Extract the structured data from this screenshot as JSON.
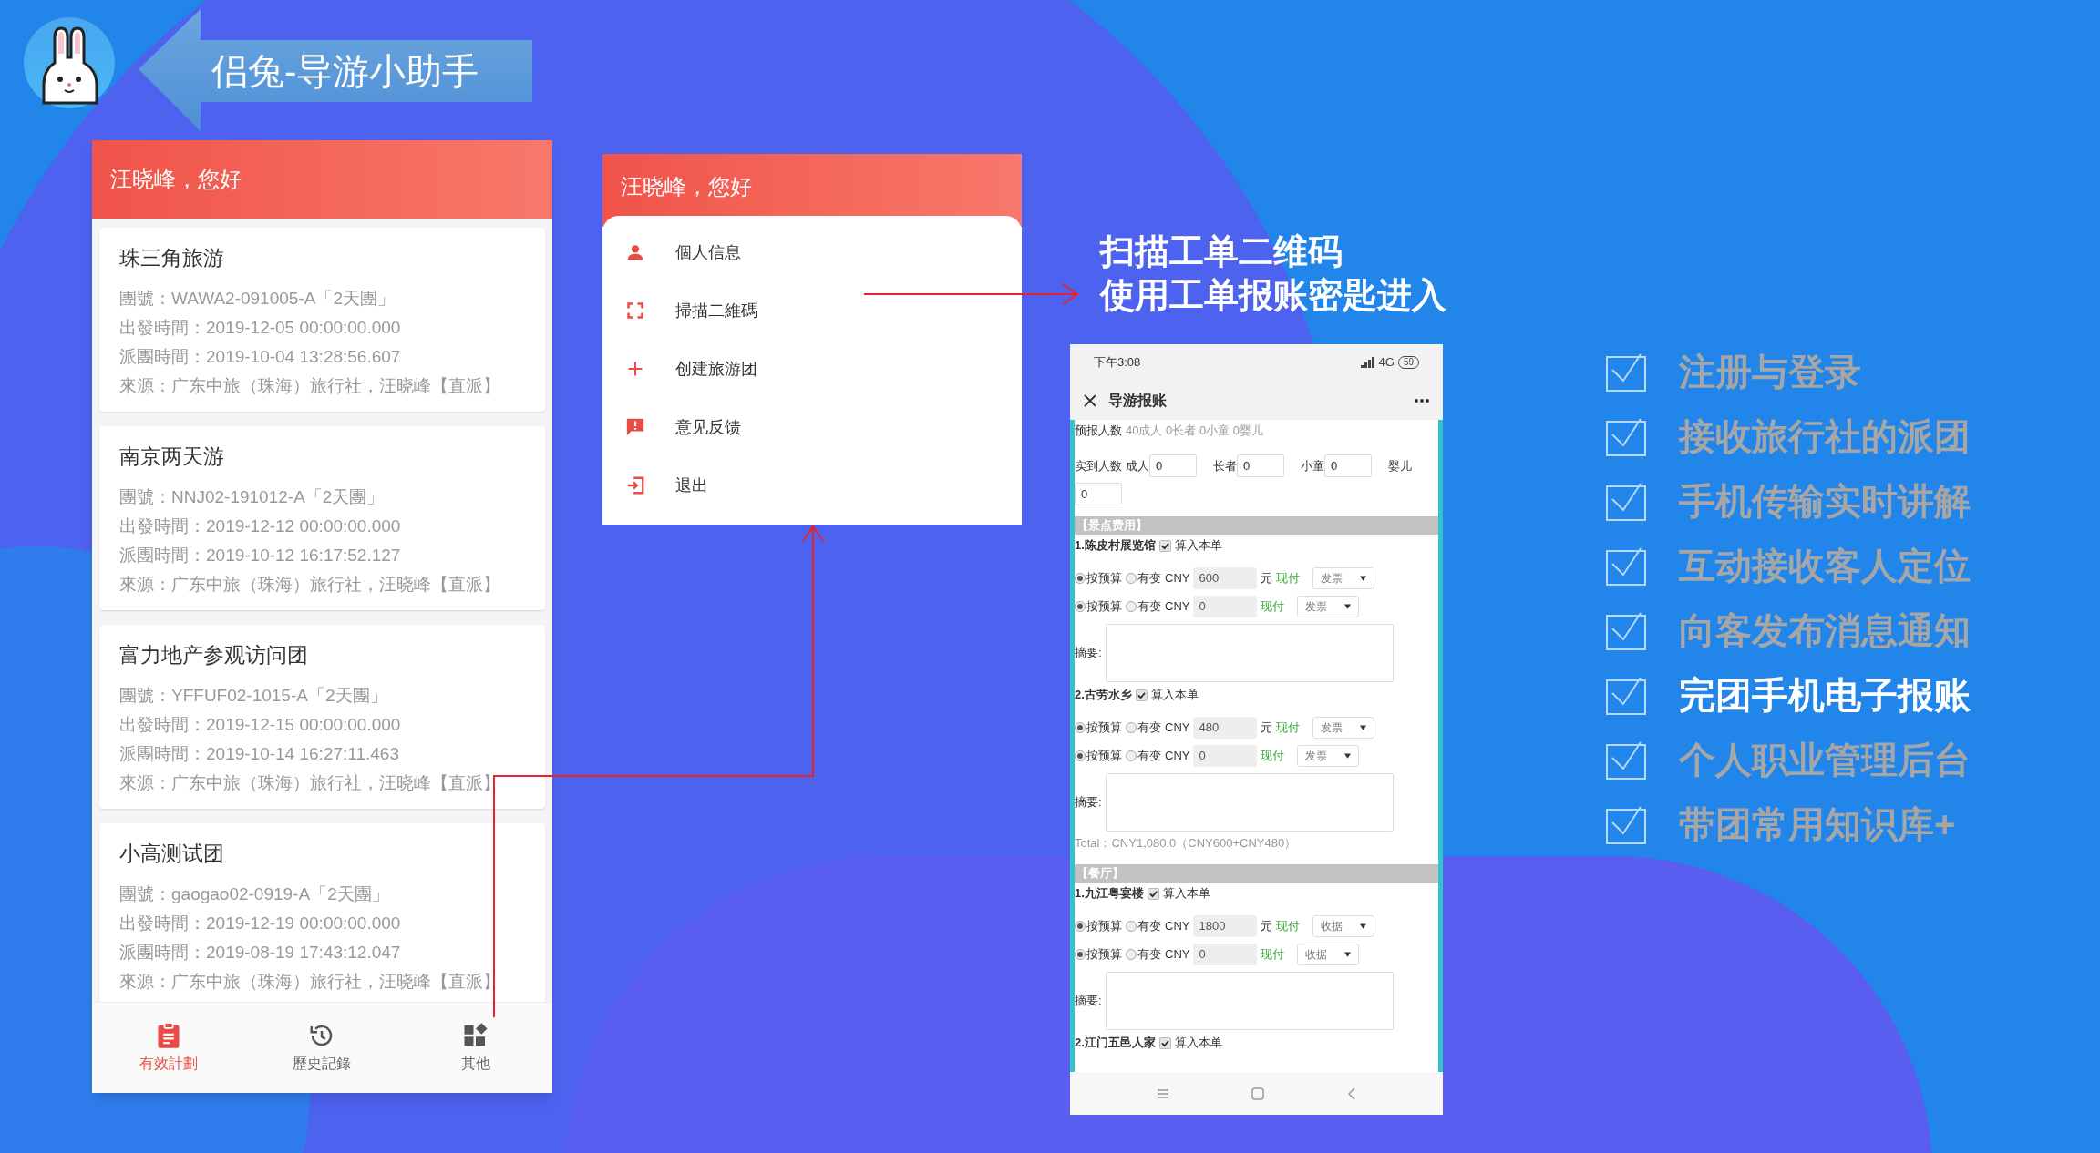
{
  "slide": {
    "title": "侣兔-导游小助手"
  },
  "plan_screen": {
    "greeting": "汪晓峰，您好",
    "tours": [
      {
        "name": "珠三角旅游",
        "fields": [
          "團號：WAWA2-091005-A「2天團」",
          "出發時間：2019-12-05 00:00:00.000",
          "派團時間：2019-10-04 13:28:56.607",
          "來源：广东中旅（珠海）旅行社，汪晓峰【直派】"
        ]
      },
      {
        "name": "南京两天游",
        "fields": [
          "團號：NNJ02-191012-A「2天團」",
          "出發時間：2019-12-12 00:00:00.000",
          "派團時間：2019-10-12 16:17:52.127",
          "來源：广东中旅（珠海）旅行社，汪晓峰【直派】"
        ]
      },
      {
        "name": "富力地产参观访问团",
        "fields": [
          "團號：YFFUF02-1015-A「2天團」",
          "出發時間：2019-12-15 00:00:00.000",
          "派團時間：2019-10-14 16:27:11.463",
          "來源：广东中旅（珠海）旅行社，汪晓峰【直派】"
        ]
      },
      {
        "name": "小高测试团",
        "fields": [
          "團號：gaogao02-0919-A「2天團」",
          "出發時間：2019-12-19 00:00:00.000",
          "派團時間：2019-08-19 17:43:12.047",
          "來源：广东中旅（珠海）旅行社，汪晓峰【直派】"
        ]
      }
    ],
    "nav": [
      {
        "kind": "plan",
        "label": "有效計劃",
        "selected": true
      },
      {
        "kind": "history",
        "label": "歷史記錄",
        "selected": false
      },
      {
        "kind": "other",
        "label": "其他",
        "selected": false
      }
    ]
  },
  "menu_screen": {
    "greeting": "汪晓峰，您好",
    "items": [
      {
        "kind": "person",
        "label": "個人信息"
      },
      {
        "kind": "scan",
        "label": "掃描二維碼"
      },
      {
        "kind": "add",
        "label": "创建旅游团"
      },
      {
        "kind": "feedback",
        "label": "意见反馈"
      },
      {
        "kind": "exit",
        "label": "退出"
      }
    ]
  },
  "caption": [
    "扫描工单二维码",
    "使用工单报账密匙进入"
  ],
  "expense_screen": {
    "status_time": "下午3:08",
    "network": "4G",
    "battery": "59",
    "title": "导游报账",
    "expected": {
      "label": "预报人数",
      "value": "40成人 0长者 0小童 0婴儿"
    },
    "actual": {
      "label": "实到人数",
      "fields": [
        {
          "label": "成人",
          "value": "0"
        },
        {
          "label": "长者",
          "value": "0"
        },
        {
          "label": "小童",
          "value": "0"
        },
        {
          "label": "婴儿",
          "value": "0"
        }
      ]
    },
    "sections": [
      {
        "title": "【景点费用】",
        "venues": [
          {
            "name": "1.陈皮村展览馆",
            "included": true,
            "include_label": "算入本单",
            "summary_label": "摘要:",
            "lines": [
              {
                "options": [
                  {
                    "label": "按预算",
                    "selected": true
                  },
                  {
                    "label": "有变",
                    "selected": false
                  }
                ],
                "currency": "CNY",
                "amount": "600",
                "unit": "元",
                "payment": "现付",
                "receipt": "发票"
              },
              {
                "options": [
                  {
                    "label": "按预算",
                    "selected": true
                  },
                  {
                    "label": "有变",
                    "selected": false
                  }
                ],
                "currency": "CNY",
                "amount": "0",
                "payment": "现付",
                "receipt": "发票"
              }
            ]
          },
          {
            "name": "2.古劳水乡",
            "included": true,
            "include_label": "算入本单",
            "summary_label": "摘要:",
            "lines": [
              {
                "options": [
                  {
                    "label": "按预算",
                    "selected": true
                  },
                  {
                    "label": "有变",
                    "selected": false
                  }
                ],
                "currency": "CNY",
                "amount": "480",
                "unit": "元",
                "payment": "现付",
                "receipt": "发票"
              },
              {
                "options": [
                  {
                    "label": "按预算",
                    "selected": true
                  },
                  {
                    "label": "有变",
                    "selected": false
                  }
                ],
                "currency": "CNY",
                "amount": "0",
                "payment": "现付",
                "receipt": "发票"
              }
            ]
          }
        ],
        "total": "Total：CNY1,080.0（CNY600+CNY480）"
      },
      {
        "title": "【餐厅】",
        "venues": [
          {
            "name": "1.九江粤宴楼",
            "included": true,
            "include_label": "算入本单",
            "summary_label": "摘要:",
            "lines": [
              {
                "options": [
                  {
                    "label": "按预算",
                    "selected": true
                  },
                  {
                    "label": "有变",
                    "selected": false
                  }
                ],
                "currency": "CNY",
                "amount": "1800",
                "unit": "元",
                "payment": "现付",
                "receipt": "收据"
              },
              {
                "options": [
                  {
                    "label": "按预算",
                    "selected": true
                  },
                  {
                    "label": "有变",
                    "selected": false
                  }
                ],
                "currency": "CNY",
                "amount": "0",
                "payment": "现付",
                "receipt": "收据"
              }
            ]
          },
          {
            "name": "2.江门五邑人家",
            "included": true,
            "include_label": "算入本单"
          }
        ]
      }
    ]
  },
  "features": [
    {
      "label": "注册与登录",
      "highlighted": false
    },
    {
      "label": "接收旅行社的派团",
      "highlighted": false
    },
    {
      "label": "手机传输实时讲解",
      "highlighted": false
    },
    {
      "label": "互动接收客人定位",
      "highlighted": false
    },
    {
      "label": "向客发布消息通知",
      "highlighted": false
    },
    {
      "label": "完团手机电子报账",
      "highlighted": true
    },
    {
      "label": "个人职业管理后台",
      "highlighted": false
    },
    {
      "label": "带团常用知识库+",
      "highlighted": false
    }
  ]
}
